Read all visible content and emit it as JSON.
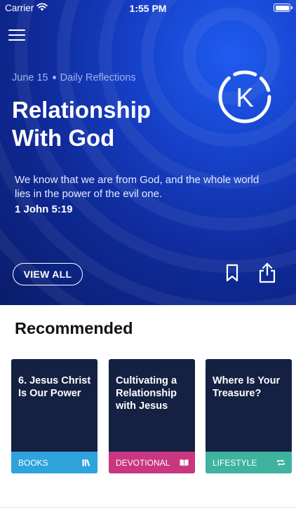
{
  "status_bar": {
    "carrier": "Carrier",
    "time": "1:55 PM"
  },
  "hero": {
    "date": "June 15",
    "category": "Daily Reflections",
    "title_line1": "Relationship",
    "title_line2": "With God",
    "logo_letter": "K",
    "verse_text": "We know that we are from God, and the whole world lies in the power of the evil one.",
    "verse_reference": "1 John 5:19",
    "view_all_label": "VIEW ALL",
    "background_colors": [
      "#1f5cf0",
      "#0f2a98",
      "#0a1c6a"
    ]
  },
  "recommended": {
    "title": "Recommended",
    "cards": [
      {
        "title": "6. Jesus Christ Is Our Power",
        "category": "BOOKS",
        "color": "#2ea3de",
        "icon": "books-icon"
      },
      {
        "title": "Cultivating a Relationship with Jesus",
        "category": "DEVOTIONAL",
        "color": "#c8377f",
        "icon": "open-book-icon"
      },
      {
        "title": "Where Is Your Treasure?",
        "category": "LIFESTYLE",
        "color": "#3fb3a0",
        "icon": "repeat-icon"
      }
    ]
  }
}
